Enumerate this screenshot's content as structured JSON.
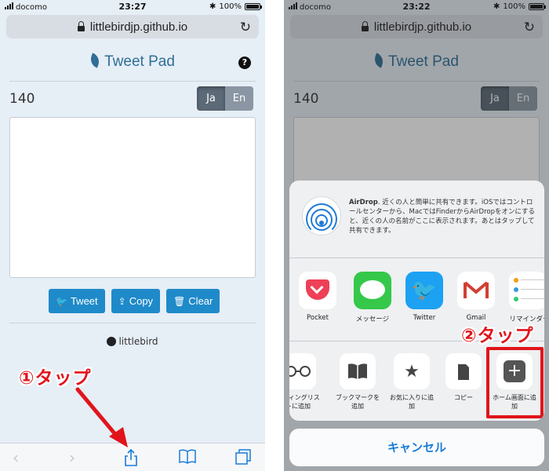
{
  "left_phone": {
    "status": {
      "carrier": "docomo",
      "time": "23:27",
      "battery": "100%"
    },
    "url": "littlebirdjp.github.io",
    "app_title": "Tweet Pad",
    "help_label": "?",
    "counter": "140",
    "lang_buttons": [
      "Ja",
      "En"
    ],
    "active_lang": "Ja",
    "buttons": {
      "tweet": "Tweet",
      "copy": "Copy",
      "clear": "Clear"
    },
    "github_link": "littlebird",
    "callout": "①タップ"
  },
  "right_phone": {
    "status": {
      "carrier": "docomo",
      "time": "23:22",
      "battery": "100%"
    },
    "url": "littlebirdjp.github.io",
    "app_title": "Tweet Pad",
    "counter": "140",
    "lang_buttons": [
      "Ja",
      "En"
    ],
    "airdrop": {
      "title": "AirDrop",
      "text": "近くの人と簡単に共有できます。iOSではコントロールセンターから、MacではFinderからAirDropをオンにすると、近くの人の名前がここに表示されます。あとはタップして共有できます。"
    },
    "apps": [
      "Pocket",
      "メッセージ",
      "Twitter",
      "Gmail",
      "リマインダー"
    ],
    "actions": [
      {
        "label": "ーディングリストに追加",
        "icon": "glasses-icon"
      },
      {
        "label": "ブックマークを追加",
        "icon": "book-icon"
      },
      {
        "label": "お気に入りに追加",
        "icon": "star-icon"
      },
      {
        "label": "コピー",
        "icon": "copy-icon"
      },
      {
        "label": "ホーム画面に追加",
        "icon": "plus-icon"
      }
    ],
    "cancel": "キャンセル",
    "callout": "②タップ"
  },
  "colors": {
    "accent_blue": "#1f8ac9",
    "title_blue": "#2f6e96",
    "annotation_red": "#e1141b",
    "ios_link_blue": "#1a7cd8"
  }
}
